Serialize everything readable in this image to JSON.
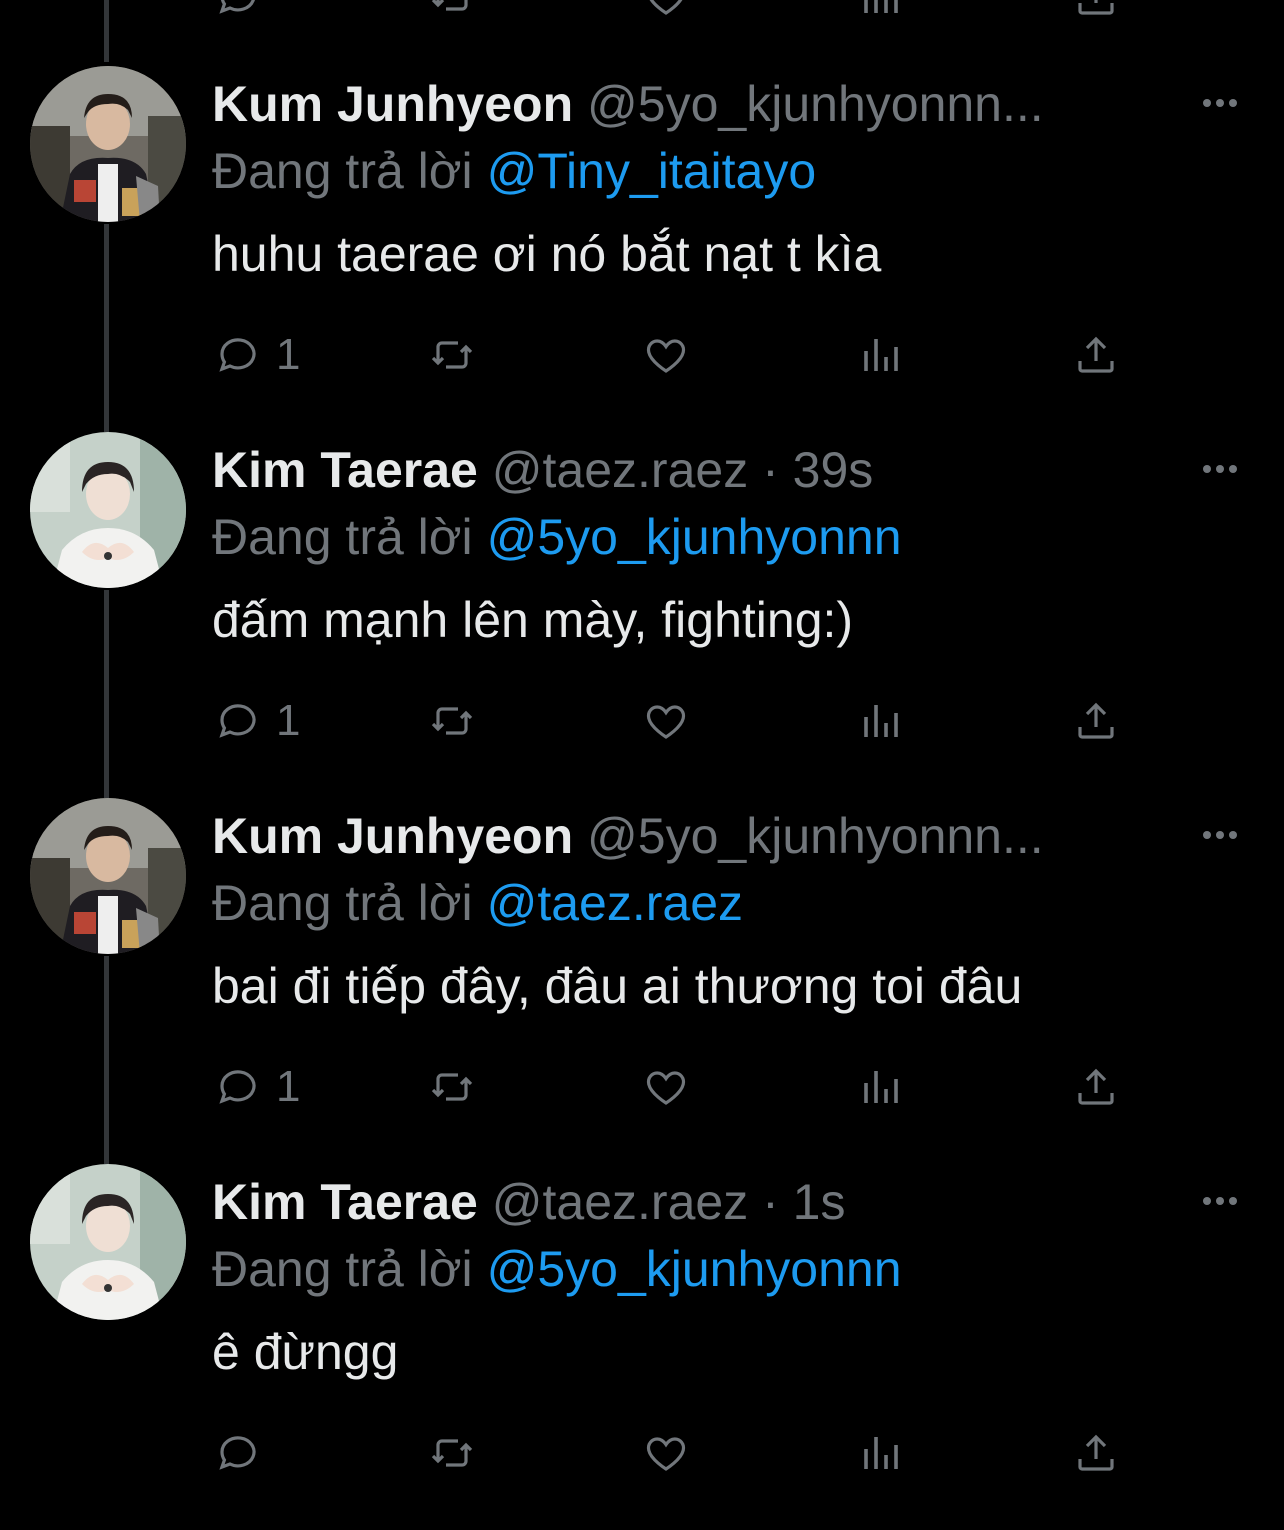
{
  "tweets": [
    {
      "name": "Kum Junhyeon",
      "handle": "@5yo_kjunhyonnn...",
      "reply_prefix": "Đang trả lời",
      "reply_to": "@Tiny_itaitayo",
      "text": "huhu taerae ơi nó bắt nạt t kìa",
      "reply_count": "1",
      "avatar": "avatar-junhyeon"
    },
    {
      "name": "Kim Taerae",
      "handle": "@taez.raez · 39s",
      "reply_prefix": "Đang trả lời",
      "reply_to": "@5yo_kjunhyonnn",
      "text": "đấm mạnh lên mày, fighting:)",
      "reply_count": "1",
      "avatar": "avatar-taerae"
    },
    {
      "name": "Kum Junhyeon",
      "handle": "@5yo_kjunhyonnn...",
      "reply_prefix": "Đang trả lời",
      "reply_to": "@taez.raez",
      "text": "bai đi tiếp đây, đâu ai thương toi đâu",
      "reply_count": "1",
      "avatar": "avatar-junhyeon"
    },
    {
      "name": "Kim Taerae",
      "handle": "@taez.raez · 1s",
      "reply_prefix": "Đang trả lời",
      "reply_to": "@5yo_kjunhyonnn",
      "text": "ê đừngg",
      "reply_count": "",
      "avatar": "avatar-taerae"
    }
  ],
  "icons": [
    "reply-icon",
    "retweet-icon",
    "like-icon",
    "views-icon",
    "share-icon",
    "more-icon"
  ],
  "colors": {
    "background": "#000000",
    "text": "#e7e9ea",
    "muted": "#71767b",
    "link": "#1d9bf0",
    "thread_line": "#333639"
  }
}
